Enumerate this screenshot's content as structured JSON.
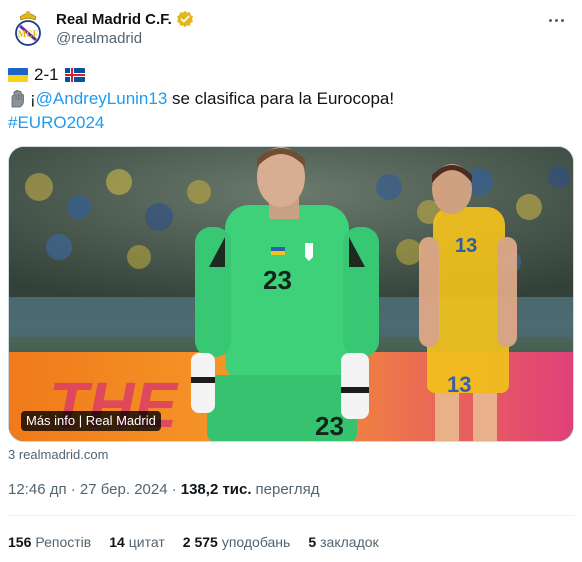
{
  "account": {
    "display_name": "Real Madrid C.F.",
    "handle": "@realmadrid",
    "verified_color": "#e2b719"
  },
  "tweet": {
    "score_line": "2-1",
    "mention": "@AndreyLunin13",
    "text_prefix": "¡",
    "text_suffix": " se clasifica para la Eurocopa!",
    "hashtag": "#EURO2024"
  },
  "media": {
    "label": "Más info | Real Madrid",
    "player_number_left": "23",
    "player_number_right": "13"
  },
  "source": "3 realmadrid.com",
  "meta": {
    "time": "12:46 дп · 27 бер. 2024 ·",
    "views_count": "138,2 тис.",
    "views_label": "перегляд"
  },
  "stats": [
    {
      "count": "156",
      "label": "Репостів"
    },
    {
      "count": "14",
      "label": "цитат"
    },
    {
      "count": "2 575",
      "label": "уподобань"
    },
    {
      "count": "5",
      "label": "закладок"
    }
  ],
  "icons": [
    "real-madrid-crest",
    "verified-badge",
    "more-icon",
    "ukraine-flag",
    "iceland-flag",
    "glove-emoji"
  ]
}
